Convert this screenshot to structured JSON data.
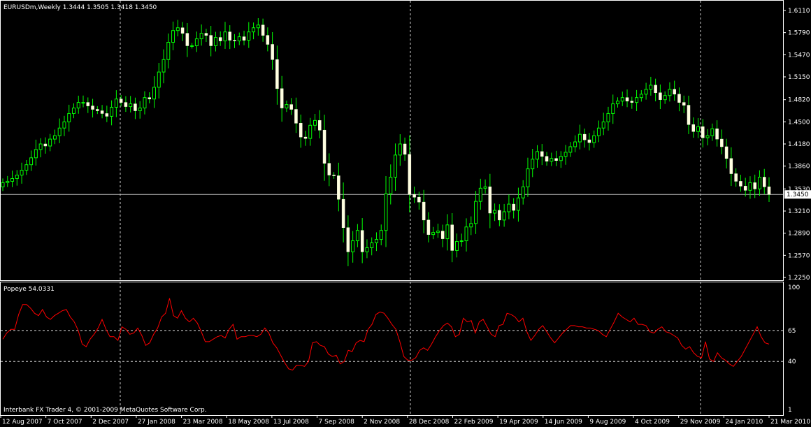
{
  "window": {
    "header": "EURUSDm,Weekly  1.3444 1.3505 1.3418 1.3450",
    "footer": "Interbank FX Trader 4, © 2001-2009 MetaQuotes Software Corp."
  },
  "colors": {
    "background": "#000000",
    "bull_candle": "#ffffe0",
    "candle_wick": "#00ff00",
    "indicator_line": "#ff0000",
    "grid": "#ffffff",
    "bid_line": "#c0c0c0"
  },
  "chart_data": [
    {
      "type": "candlestick",
      "symbol": "EURUSDm",
      "timeframe": "Weekly",
      "last_ohlc": {
        "open": 1.3444,
        "high": 1.3505,
        "low": 1.3418,
        "close": 1.345
      },
      "current_price_label": "1.3450",
      "y_ticks": [
        "1.6110",
        "1.5790",
        "1.5470",
        "1.5150",
        "1.4820",
        "1.4500",
        "1.4180",
        "1.3860",
        "1.3530",
        "1.3210",
        "1.2890",
        "1.2570",
        "1.2250"
      ],
      "ylim": [
        1.225,
        1.611
      ],
      "x_tick_labels": [
        "12 Aug 2007",
        "7 Oct 2007",
        "2 Dec 2007",
        "27 Jan 2008",
        "23 Mar 2008",
        "18 May 2008",
        "13 Jul 2008",
        "7 Sep 2008",
        "2 Nov 2008",
        "28 Dec 2008",
        "22 Feb 2009",
        "19 Apr 2009",
        "14 Jun 2009",
        "9 Aug 2009",
        "4 Oct 2009",
        "29 Nov 2009",
        "24 Jan 2010",
        "21 Mar 2010"
      ],
      "close_series_estimated": [
        1.362,
        1.364,
        1.368,
        1.373,
        1.38,
        1.388,
        1.398,
        1.41,
        1.418,
        1.415,
        1.425,
        1.43,
        1.441,
        1.45,
        1.462,
        1.47,
        1.478,
        1.478,
        1.473,
        1.468,
        1.466,
        1.462,
        1.458,
        1.471,
        1.483,
        1.478,
        1.472,
        1.476,
        1.466,
        1.47,
        1.485,
        1.483,
        1.5,
        1.522,
        1.54,
        1.565,
        1.582,
        1.586,
        1.578,
        1.56,
        1.56,
        1.57,
        1.578,
        1.575,
        1.56,
        1.572,
        1.567,
        1.58,
        1.568,
        1.567,
        1.573,
        1.568,
        1.58,
        1.586,
        1.59,
        1.575,
        1.562,
        1.54,
        1.498,
        1.47,
        1.475,
        1.468,
        1.448,
        1.428,
        1.426,
        1.445,
        1.452,
        1.438,
        1.39,
        1.373,
        1.372,
        1.338,
        1.297,
        1.262,
        1.278,
        1.293,
        1.262,
        1.268,
        1.275,
        1.28,
        1.293,
        1.346,
        1.37,
        1.402,
        1.418,
        1.403,
        1.345,
        1.341,
        1.334,
        1.308,
        1.287,
        1.29,
        1.292,
        1.281,
        1.301,
        1.264,
        1.277,
        1.278,
        1.298,
        1.303,
        1.335,
        1.354,
        1.356,
        1.318,
        1.322,
        1.308,
        1.32,
        1.331,
        1.322,
        1.34,
        1.356,
        1.382,
        1.396,
        1.407,
        1.4,
        1.393,
        1.397,
        1.394,
        1.4,
        1.406,
        1.414,
        1.421,
        1.432,
        1.424,
        1.42,
        1.43,
        1.441,
        1.45,
        1.462,
        1.476,
        1.48,
        1.485,
        1.48,
        1.478,
        1.485,
        1.49,
        1.497,
        1.503,
        1.492,
        1.482,
        1.488,
        1.497,
        1.49,
        1.478,
        1.474,
        1.446,
        1.436,
        1.443,
        1.427,
        1.43,
        1.44,
        1.425,
        1.414,
        1.397,
        1.375,
        1.364,
        1.357,
        1.351,
        1.362,
        1.353,
        1.37,
        1.356,
        1.345
      ]
    },
    {
      "type": "line",
      "name": "Popeye",
      "header": "Popeye 54.0331",
      "last_value": 54.0331,
      "y_ticks": [
        "100",
        "65",
        "40",
        "1"
      ],
      "levels": [
        65,
        40
      ],
      "ylim": [
        0,
        100
      ],
      "values_estimated": [
        58,
        63,
        66,
        66,
        78,
        86,
        86,
        83,
        79,
        77,
        82,
        76,
        74,
        77,
        79,
        81,
        82,
        76,
        72,
        65,
        54,
        52,
        58,
        62,
        67,
        74,
        66,
        60,
        60,
        57,
        68,
        66,
        62,
        63,
        67,
        61,
        53,
        55,
        62,
        67,
        76,
        79,
        91,
        77,
        75,
        81,
        75,
        72,
        75,
        71,
        64,
        56,
        56,
        58,
        60,
        61,
        59,
        66,
        70,
        58,
        60,
        60,
        61,
        61,
        60,
        62,
        67,
        63,
        55,
        51,
        45,
        39,
        34,
        33,
        37,
        37,
        36,
        40,
        55,
        56,
        53,
        52,
        46,
        44,
        45,
        38,
        40,
        49,
        48,
        55,
        57,
        56,
        66,
        70,
        78,
        80,
        79,
        75,
        70,
        66,
        56,
        44,
        41,
        41,
        43,
        49,
        51,
        49,
        54,
        60,
        65,
        69,
        71,
        68,
        60,
        62,
        75,
        72,
        73,
        63,
        72,
        74,
        68,
        62,
        60,
        69,
        70,
        79,
        78,
        76,
        72,
        75,
        64,
        57,
        61,
        66,
        69,
        64,
        59,
        55,
        59,
        63,
        66,
        69,
        69,
        68,
        68,
        67,
        67,
        66,
        65,
        62,
        60,
        66,
        72,
        79,
        76,
        74,
        72,
        75,
        70,
        70,
        69,
        64,
        63,
        66,
        68,
        64,
        63,
        61,
        59,
        53,
        50,
        52,
        47,
        44,
        43,
        56,
        42,
        40,
        47,
        43,
        41,
        38,
        36,
        40,
        44,
        50,
        56,
        62,
        68,
        60,
        55,
        54
      ]
    }
  ]
}
